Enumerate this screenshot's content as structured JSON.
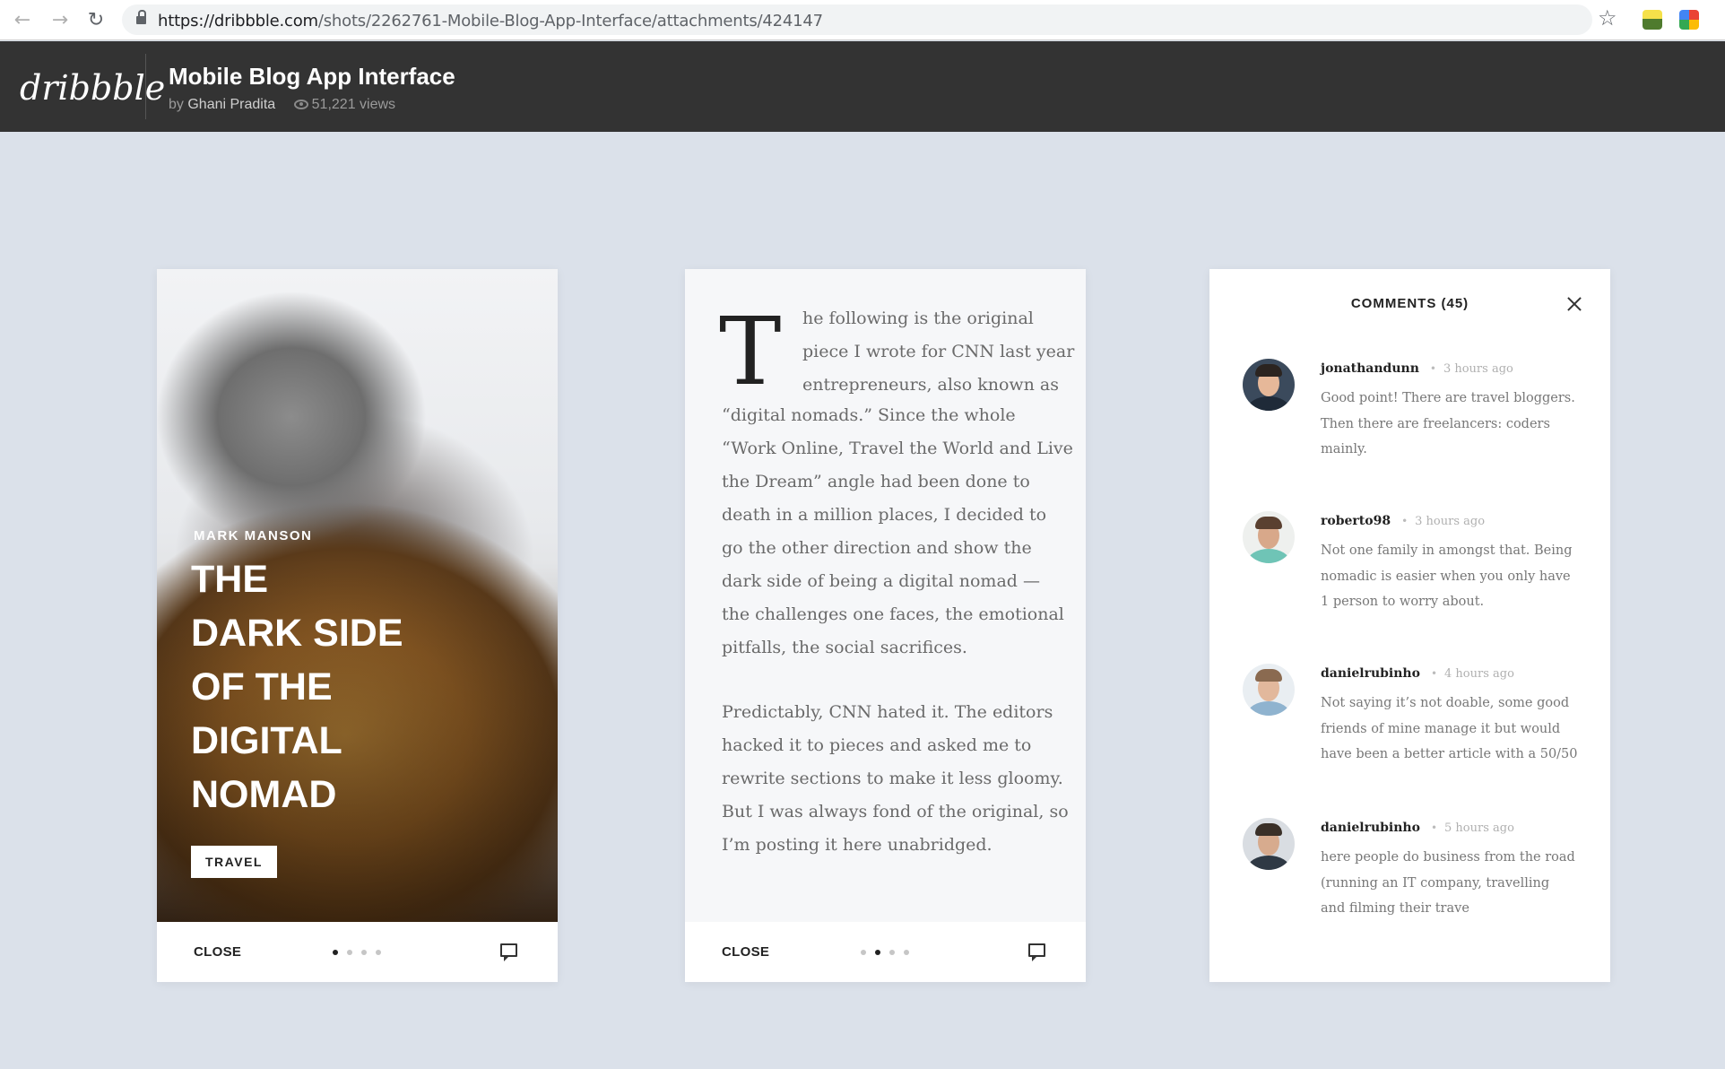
{
  "browser": {
    "url_host": "https://dribbble.com",
    "url_path": "/shots/2262761-Mobile-Blog-App-Interface/attachments/424147"
  },
  "header": {
    "logo": "dribbble",
    "title": "Mobile Blog App Interface",
    "by": "by",
    "author": "Ghani Pradita",
    "views": "51,221 views"
  },
  "card1": {
    "author": "MARK MANSON",
    "title_lines": [
      "THE",
      "DARK SIDE",
      "OF THE",
      "DIGITAL",
      "NOMAD"
    ],
    "tag": "TRAVEL",
    "close": "CLOSE",
    "active_dot": 1
  },
  "card2": {
    "dropcap": "T",
    "lines": [
      "he following is the original",
      "piece I wrote for CNN last year",
      "entrepreneurs, also known as",
      "“digital nomads.” Since the whole",
      "“Work Online, Travel the World and Live",
      "the Dream” angle had been done to",
      "death in a million places, I decided to",
      "go the other direction and show the",
      "dark side of being a digital nomad —",
      "the challenges one faces, the emotional",
      "pitfalls, the social sacrifices.",
      "Predictably, CNN hated it. The editors",
      "hacked it to pieces and asked me to",
      "rewrite sections to make it less gloomy.",
      "But I was always fond of the original, so",
      "I’m posting it here unabridged."
    ],
    "close": "CLOSE",
    "active_dot": 2
  },
  "card3": {
    "title": "COMMENTS (45)",
    "comments": [
      {
        "user": "jonathandunn",
        "time": "3 hours ago",
        "lines": [
          "Good point! There are travel bloggers.",
          "Then there are freelancers: coders",
          "mainly."
        ]
      },
      {
        "user": "roberto98",
        "time": "3 hours ago",
        "lines": [
          "Not one family in amongst that. Being",
          "nomadic is easier when you only have",
          "1 person to worry about."
        ]
      },
      {
        "user": "danielrubinho",
        "time": "4 hours ago",
        "lines": [
          "Not saying it’s not doable, some good",
          "friends of mine manage it but would",
          "have been a better article with a 50/50"
        ]
      },
      {
        "user": "danielrubinho",
        "time": "5 hours ago",
        "lines": [
          "here people do business from the road",
          "(running an IT company, travelling",
          "and filming their trave"
        ]
      }
    ]
  }
}
